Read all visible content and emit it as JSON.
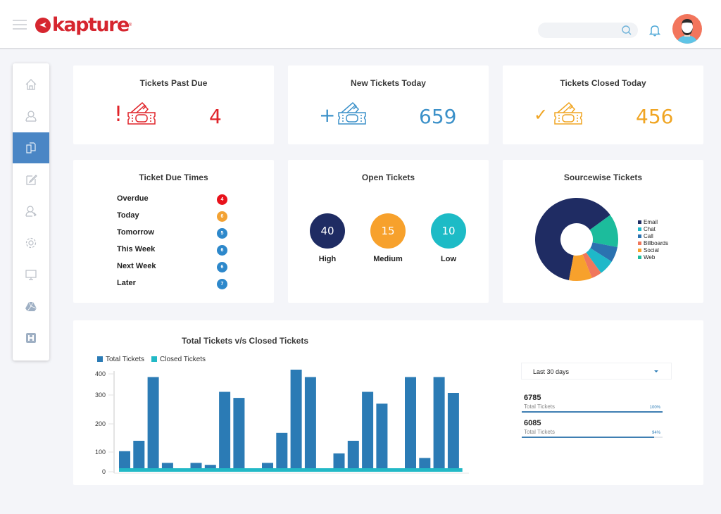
{
  "header": {
    "logo_text": "kapture",
    "logo_reg": "®",
    "search_placeholder": "",
    "icons": [
      "hamburger-menu-icon",
      "search-icon",
      "bell-icon",
      "user-avatar"
    ]
  },
  "sidebar": {
    "active_index": 2,
    "items": [
      {
        "name": "home",
        "icon": "home-icon"
      },
      {
        "name": "contacts",
        "icon": "user-icon"
      },
      {
        "name": "tickets",
        "icon": "documents-icon"
      },
      {
        "name": "edit",
        "icon": "edit-icon"
      },
      {
        "name": "agents",
        "icon": "agent-icon"
      },
      {
        "name": "settings",
        "icon": "gear-icon"
      },
      {
        "name": "monitor",
        "icon": "monitor-icon"
      },
      {
        "name": "drive",
        "icon": "drive-icon"
      },
      {
        "name": "help",
        "icon": "h-icon"
      }
    ]
  },
  "stats": [
    {
      "title": "Tickets Past Due",
      "prefix": "!",
      "value": "4",
      "color": "#e0242a"
    },
    {
      "title": "New Tickets Today",
      "prefix": "+",
      "value": "659",
      "color": "#3c91c9"
    },
    {
      "title": "Tickets Closed Today",
      "prefix": "✓",
      "value": "456",
      "color": "#f0a523"
    }
  ],
  "due_times": {
    "title": "Ticket  Due Times",
    "rows": [
      {
        "label": "Overdue",
        "count": "4",
        "color": "#e8121b"
      },
      {
        "label": "Today",
        "count": "6",
        "color": "#f3a233"
      },
      {
        "label": "Tomorrow",
        "count": "5",
        "color": "#2d88cb"
      },
      {
        "label": "This Week",
        "count": "6",
        "color": "#2d88cb"
      },
      {
        "label": "Next Week",
        "count": "6",
        "color": "#2d88cb"
      },
      {
        "label": "Later",
        "count": "7",
        "color": "#2d88cb"
      }
    ]
  },
  "open_tickets": {
    "title": "Open Tickets",
    "items": [
      {
        "label": "High",
        "value": "40",
        "color": "#1f2c63"
      },
      {
        "label": "Medium",
        "value": "15",
        "color": "#f7a12c"
      },
      {
        "label": "Low",
        "value": "10",
        "color": "#1dbbc6"
      }
    ]
  },
  "sourcewise": {
    "title": "Sourcewise Tickets"
  },
  "totals_panel": {
    "range_label": "Last 30 days",
    "metrics": [
      {
        "value": "6785",
        "label": "Total Tickets",
        "percent_text": "100%",
        "fraction": 1.0
      },
      {
        "value": "6085",
        "label": "Total Tickets",
        "percent_text": "94%",
        "fraction": 0.94
      }
    ]
  },
  "chart_data": [
    {
      "type": "pie",
      "title": "Sourcewise Tickets",
      "donut": true,
      "legend": "right",
      "slices": [
        {
          "label": "Email",
          "value": 62,
          "color": "#1f2c63"
        },
        {
          "label": "Web",
          "value": 13,
          "color": "#1cbc9c"
        },
        {
          "label": "Call",
          "value": 6,
          "color": "#2b72b0"
        },
        {
          "label": "Chat",
          "value": 6,
          "color": "#1eb8c9"
        },
        {
          "label": "Billboards",
          "value": 4,
          "color": "#f0775c"
        },
        {
          "label": "Social",
          "value": 9,
          "color": "#f7a12c"
        }
      ],
      "legend_order": [
        "Email",
        "Chat",
        "Call",
        "Billboards",
        "Social",
        "Web"
      ]
    },
    {
      "type": "bar",
      "title": "Total Tickets v/s Closed Tickets",
      "xlabel": "",
      "ylabel": "",
      "yticks": [
        0,
        100,
        200,
        300,
        400
      ],
      "ylim": [
        0,
        430
      ],
      "grid": false,
      "legend": "top-left",
      "series": [
        {
          "name": "Total Tickets",
          "color": "#2b7bb5",
          "values": [
            103,
            140,
            385,
            45,
            0,
            45,
            35,
            315,
            290,
            0,
            45,
            168,
            420,
            385,
            0,
            93,
            140,
            315,
            270,
            0,
            385,
            70,
            385,
            310
          ]
        },
        {
          "name": "Closed Tickets",
          "color": "#22b9c6",
          "values": [
            12,
            12,
            12,
            12,
            12,
            12,
            12,
            12,
            12,
            12,
            12,
            12,
            12,
            12,
            12,
            12,
            12,
            12,
            12,
            12,
            12,
            12,
            12,
            12
          ]
        }
      ]
    }
  ]
}
